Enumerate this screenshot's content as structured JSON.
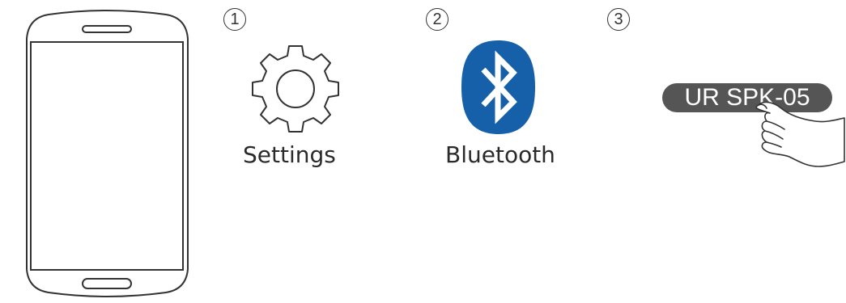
{
  "steps": [
    {
      "number": "1",
      "label": "Settings",
      "icon": "gear-icon"
    },
    {
      "number": "2",
      "label": "Bluetooth",
      "icon": "bluetooth-icon"
    },
    {
      "number": "3",
      "device_name": "UR SPK-05",
      "icon": "hand-tap-icon"
    }
  ],
  "colors": {
    "bluetooth_blue": "#1560a8",
    "pill_gray": "#555555",
    "outline": "#333333"
  }
}
